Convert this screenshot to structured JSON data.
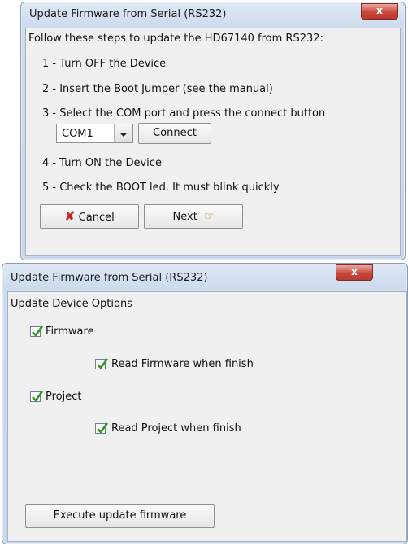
{
  "dialog1": {
    "title": "Update Firmware from Serial (RS232)",
    "close": "x",
    "intro": "Follow these steps to update the HD67140 from RS232:",
    "steps": [
      "1 - Turn OFF the Device",
      "2 - Insert the Boot Jumper (see the manual)",
      "3 - Select the  COM port and press the connect button",
      "4 - Turn ON the Device",
      "5 - Check the BOOT led. It must blink quickly"
    ],
    "com_port": "COM1",
    "connect_label": "Connect",
    "cancel_label": "Cancel",
    "next_label": "Next"
  },
  "dialog2": {
    "title": "Update Firmware from Serial (RS232)",
    "close": "x",
    "heading": "Update Device Options",
    "options": [
      {
        "label": "Firmware",
        "checked": true
      },
      {
        "label": "Read Firmware when finish",
        "checked": true
      },
      {
        "label": "Project",
        "checked": true
      },
      {
        "label": "Read Project when finish",
        "checked": true
      }
    ],
    "execute_label": "Execute update firmware"
  }
}
